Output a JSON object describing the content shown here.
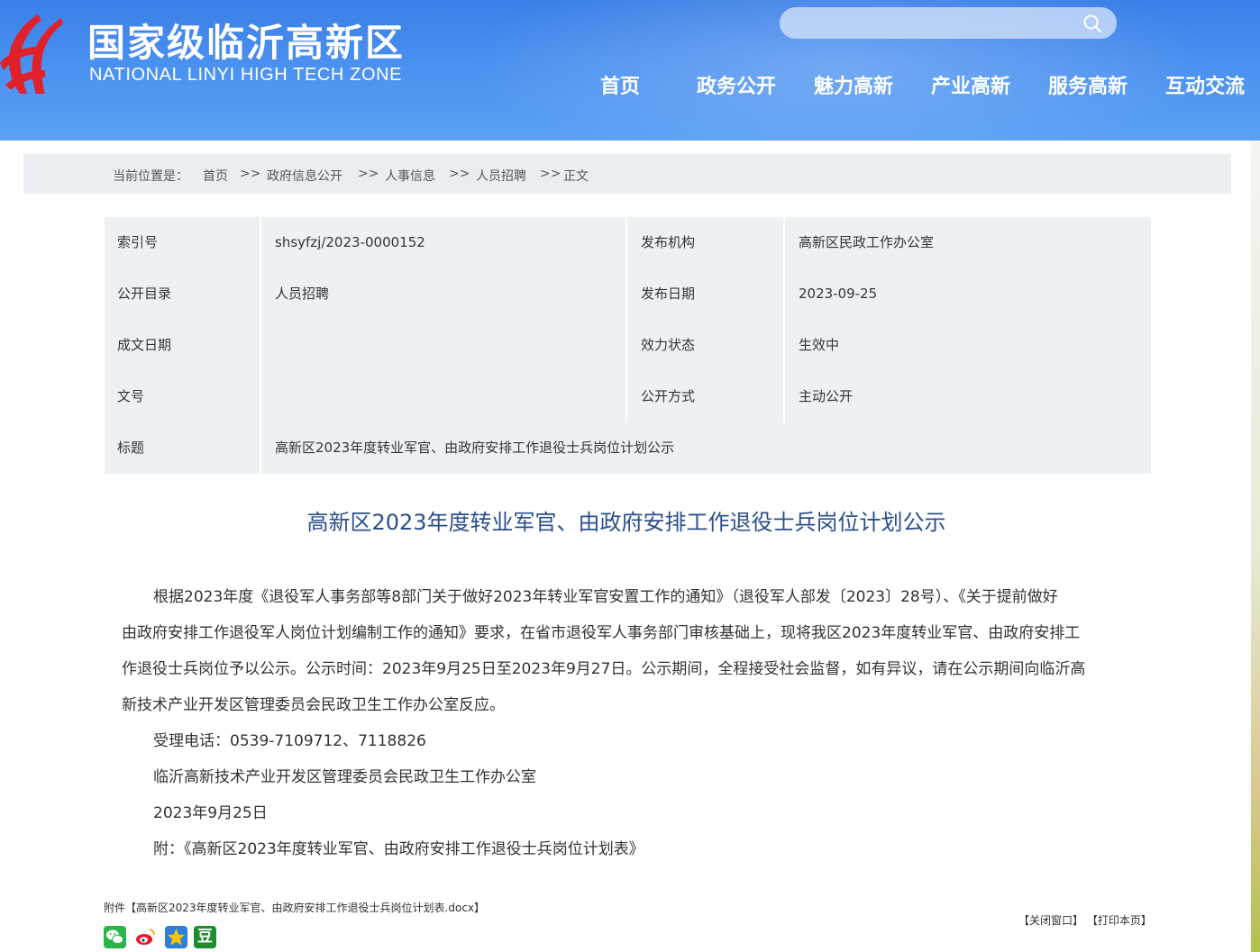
{
  "header": {
    "title": "国家级临沂高新区",
    "subtitle": "NATIONAL LINYI HIGH TECH ZONE",
    "search_placeholder": "",
    "colors": {
      "header_blue": "#4a90f0",
      "logo_red": "#e0202a",
      "nav_text": "#ffffff"
    }
  },
  "nav": {
    "items": [
      {
        "label": "首页"
      },
      {
        "label": "政务公开"
      },
      {
        "label": "魅力高新"
      },
      {
        "label": "产业高新"
      },
      {
        "label": "服务高新"
      },
      {
        "label": "互动交流"
      }
    ]
  },
  "breadcrumb": {
    "prefix": "当前位置是：",
    "items": [
      "首页",
      "政府信息公开",
      "人事信息",
      "人员招聘"
    ],
    "separator": ">>",
    "current": "正文"
  },
  "meta": {
    "rows": [
      {
        "k1": "索引号",
        "v1": "shsyfzj/2023-0000152",
        "k2": "发布机构",
        "v2": "高新区民政工作办公室"
      },
      {
        "k1": "公开目录",
        "v1": "人员招聘",
        "k2": "发布日期",
        "v2": "2023-09-25"
      },
      {
        "k1": "成文日期",
        "v1": "",
        "k2": "效力状态",
        "v2": "生效中"
      },
      {
        "k1": "文号",
        "v1": "",
        "k2": "公开方式",
        "v2": "主动公开"
      }
    ],
    "title_row": {
      "k": "标题",
      "v": "高新区2023年度转业军官、由政府安排工作退役士兵岗位计划公示"
    }
  },
  "article": {
    "title": "高新区2023年度转业军官、由政府安排工作退役士兵岗位计划公示",
    "body_lines": [
      "根据2023年度《退役军人事务部等8部门关于做好2023年转业军官安置工作的通知》（退役军人部发〔2023〕28号）、《关于提前做好",
      "由政府安排工作退役军人岗位计划编制工作的通知》要求，在省市退役军人事务部门审核基础上，现将我区2023年度转业军官、由政府安排工",
      "作退役士兵岗位予以公示。公示时间：2023年9月25日至2023年9月27日。公示期间，全程接受社会监督，如有异议，请在公示期间向临沂高",
      "新技术产业开发区管理委员会民政卫生工作办公室反应。"
    ],
    "phone": "受理电话：0539-7109712、7118826",
    "office": "临沂高新技术产业开发区管理委员会民政卫生工作办公室",
    "date": "2023年9月25日",
    "appendix": "附：《高新区2023年度转业军官、由政府安排工作退役士兵岗位计划表》"
  },
  "footer": {
    "attachment_prefix": "附件",
    "attachment_link": "【高新区2023年度转业军官、由政府安排工作退役士兵岗位计划表.docx】",
    "close_label": "【关闭窗口】",
    "print_label": "【打印本页】",
    "share_icons": [
      "wechat-icon",
      "weibo-icon",
      "qzone-icon",
      "douban-icon"
    ],
    "douban_glyph": "豆"
  }
}
